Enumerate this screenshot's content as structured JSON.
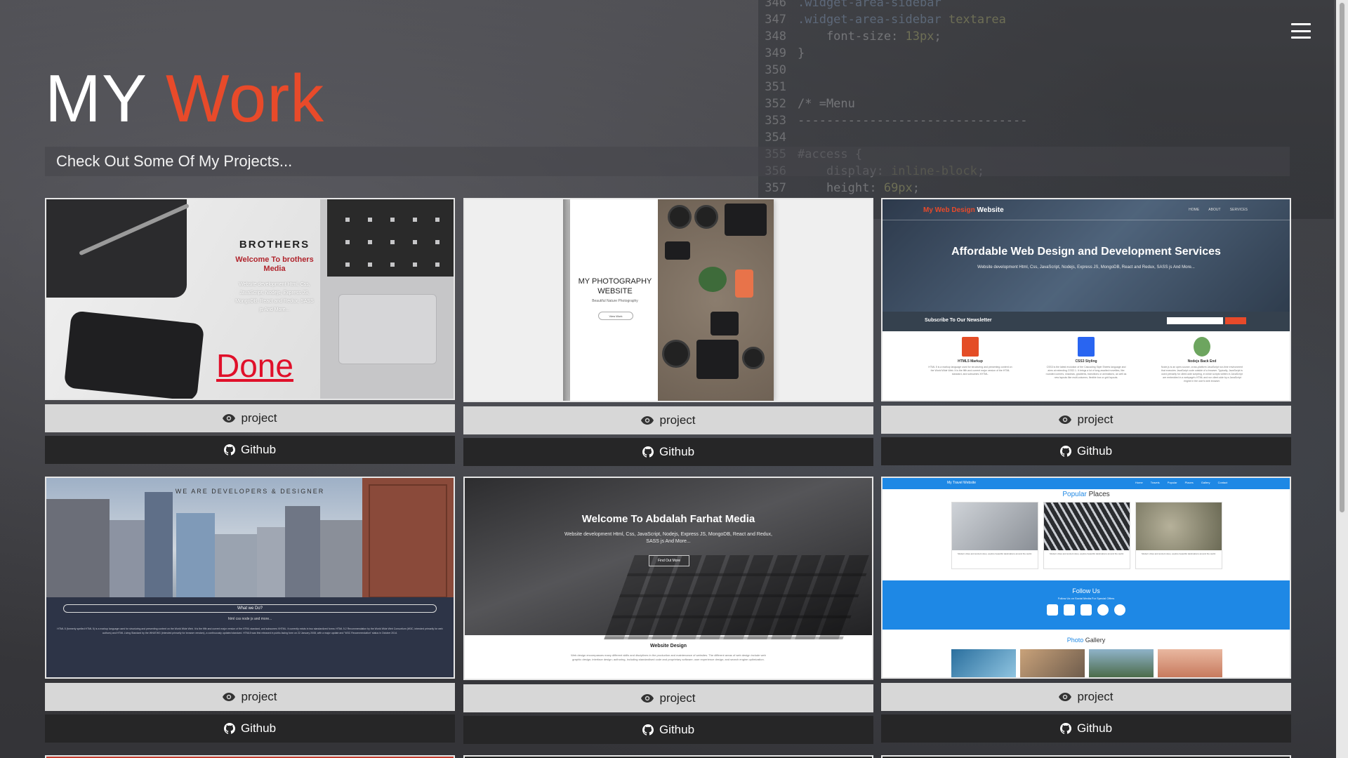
{
  "page": {
    "title_main": "MY",
    "title_accent": "Work",
    "subtitle": "Check Out Some Of My Projects...",
    "accent_color": "#e84a2a"
  },
  "menu": {
    "icon": "hamburger-menu-icon"
  },
  "projects": [
    {
      "project_label": "project",
      "github_label": "Github",
      "preview": {
        "brand": "BROTHERS",
        "welcome": "Welcome To brothers Media",
        "description": "Website development Html, Css, JavaScript, Nodejs, Express JS, MongoDB, React and Redux, SASS js And More...",
        "status": "Done"
      }
    },
    {
      "project_label": "project",
      "github_label": "Github",
      "preview": {
        "title": "MY PHOTOGRAPHY WEBSITE",
        "subtitle": "Beautiful Nature Photography",
        "button": "View Work"
      }
    },
    {
      "project_label": "project",
      "github_label": "Github",
      "preview": {
        "logo_accent": "My Web Design",
        "logo_rest": "Website",
        "nav": "HOME ABOUT SERVICES",
        "headline": "Affordable Web Design and Development Services",
        "headline_sub": "Website development Html, Css, JavaScript, Nodejs, Express JS, MongoDB, React and Redux, SASS js And More...",
        "newsletter": "Subscribe To Our Newsletter",
        "features": [
          {
            "title": "HTML5 Markup",
            "color": "#e44d26",
            "text": "HTML 5 is a markup language used for structuring and presenting content on the World Wide Web. It is the fifth and current major version of the HTML standard, and subsumes XHTML."
          },
          {
            "title": "CSS3 Styling",
            "color": "#2965f1",
            "text": "CSS3 is the latest evolution of the Cascading Style Sheets language and aims at extending CSS2.1. It brings a lot of long-awaited novelties, like rounded corners, shadows, gradients, transitions or animations, as well as new layouts like multi-columns, flexible box or grid layouts."
          },
          {
            "title": "Nodejs Back End",
            "color": "#6da55f",
            "text": "Node.js is an open-source, cross-platform JavaScript run-time environment that executes JavaScript code outside of a browser. Typically, JavaScript is used primarily for client-side scripting, in which scripts written in JavaScript are embedded in a webpage's HTML and run client-side by a JavaScript engine in the user's web browser."
          }
        ]
      }
    },
    {
      "project_label": "project",
      "github_label": "Github",
      "preview": {
        "tagline": "WE ARE DEVELOPERS & DESIGNER",
        "what": "What we Do?",
        "sub": "html css node js and more...",
        "text": "HTML 5 (formerly spelled HTML 5) is a markup language used for structuring and presenting content on the World Wide Web. It is the fifth and current major version of the HTML standard, and subsumes XHTML. It currently exists in two standardized forms: HTML 5.2 Recommendation by the World Wide Web Consortium (W3C, intended primarily for web authors) and HTML Living Standard by the WHATWG (intended primarily for browser vendors), a continuously updated standard. HTML5 was first released in public-facing form on 22 January 2008, with a major update and \"W3C Recommendation\" status in October 2014."
      }
    },
    {
      "project_label": "project",
      "github_label": "Github",
      "preview": {
        "headline": "Welcome To Abdalah Farhat Media",
        "sub": "Website development Html, Css, JavaScript, Nodejs, Express JS, MongoDB, React and Redux, SASS js And More...",
        "button": "Find Out More",
        "section": "Website Design",
        "section_text": "Web design encompasses many different skills and disciplines in the production and maintenance of websites. The different areas of web design include web graphic design; interface design; authoring, including standardised code and proprietary software; user experience design; and search engine optimization."
      }
    },
    {
      "project_label": "project",
      "github_label": "Github",
      "preview": {
        "nav_left": "My Travel Website",
        "nav_right": "Home Travels Popular Places Gallery Contact",
        "popular_a": "Popular",
        "popular_b": "Places",
        "place_text": "Modern cities and ancient sites, explore beautiful destinations around the world.",
        "follow": "Follow Us",
        "follow_sub": "Follow Us on Social Media For Special Offers",
        "gallery_a": "Photo",
        "gallery_b": "Gallery"
      }
    }
  ]
}
